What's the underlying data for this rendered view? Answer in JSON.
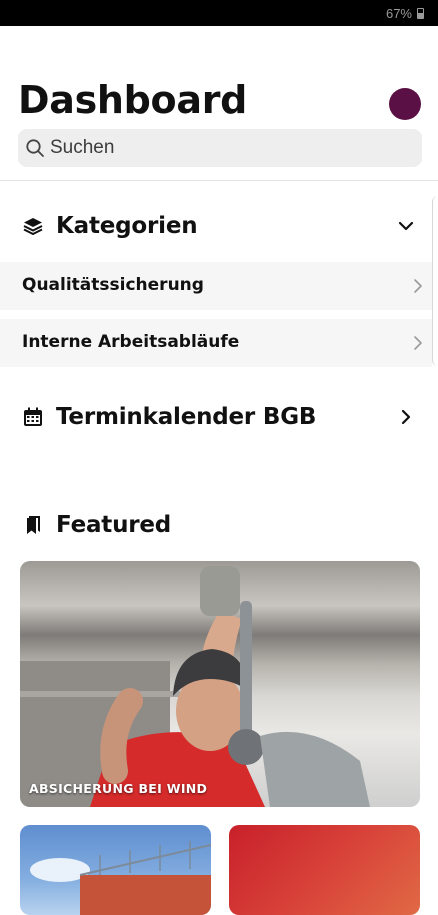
{
  "status_bar": {
    "battery_text": "67%"
  },
  "header": {
    "title": "Dashboard"
  },
  "search": {
    "placeholder": "Suchen"
  },
  "categories": {
    "label": "Kategorien",
    "items": [
      {
        "label": "Qualitätssicherung"
      },
      {
        "label": "Interne Arbeitsabläufe"
      }
    ]
  },
  "calendar": {
    "label": "Terminkalender BGB"
  },
  "featured": {
    "label": "Featured",
    "cards": [
      {
        "title": "ABSICHERUNG BEI WIND"
      }
    ]
  },
  "colors": {
    "avatar": "#5a1044",
    "search_bg": "#eeeeef",
    "sub_item_bg": "#f6f6f6"
  }
}
